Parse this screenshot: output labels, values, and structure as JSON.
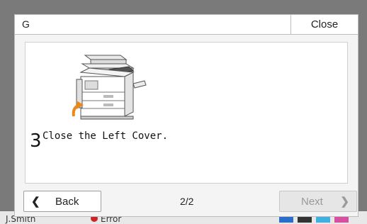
{
  "dialog": {
    "title": "G",
    "close_label": "Close",
    "step_number": "3",
    "instruction": "Close the Left Cover.",
    "page_indicator": "2/2",
    "back_label": "Back",
    "next_label": "Next",
    "next_enabled": false
  },
  "status_bar": {
    "user": "J.Smith",
    "status": "Error"
  },
  "colors": {
    "dialog_bg": "#f4f4f4",
    "disabled_text": "#9a9a9a",
    "error_dot": "#c62828"
  },
  "icons": [
    "chevron-left-icon",
    "chevron-right-icon",
    "printer-illustration",
    "error-icon"
  ]
}
